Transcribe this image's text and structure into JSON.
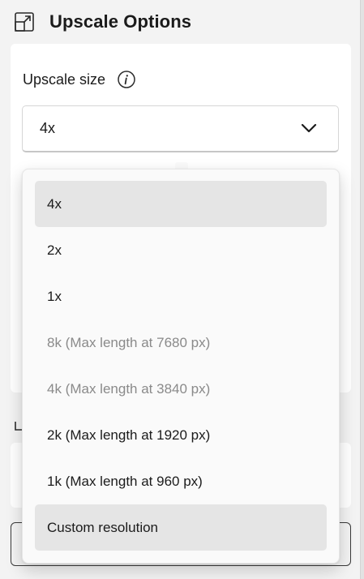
{
  "panel": {
    "title": "Upscale Options",
    "title_icon": "resize-expand-icon"
  },
  "upscale": {
    "label": "Upscale size",
    "info_icon": "info-icon",
    "selected": "4x",
    "chevron_icon": "chevron-down-icon"
  },
  "dropdown": {
    "options": [
      {
        "label": "4x",
        "state": "selected"
      },
      {
        "label": "2x",
        "state": "normal"
      },
      {
        "label": "1x",
        "state": "normal"
      },
      {
        "label": "8k (Max length at 7680 px)",
        "state": "disabled"
      },
      {
        "label": "4k (Max length at 3840 px)",
        "state": "disabled"
      },
      {
        "label": "2k (Max length at 1920 px)",
        "state": "normal"
      },
      {
        "label": "1k (Max length at 960 px)",
        "state": "normal"
      },
      {
        "label": "Custom resolution",
        "state": "hover"
      }
    ]
  },
  "colors": {
    "background": "#f3f3f3",
    "card": "#ffffff",
    "menu": "#fafafa",
    "highlight": "#e5e5e5",
    "disabled_text": "#8a8a8a"
  }
}
